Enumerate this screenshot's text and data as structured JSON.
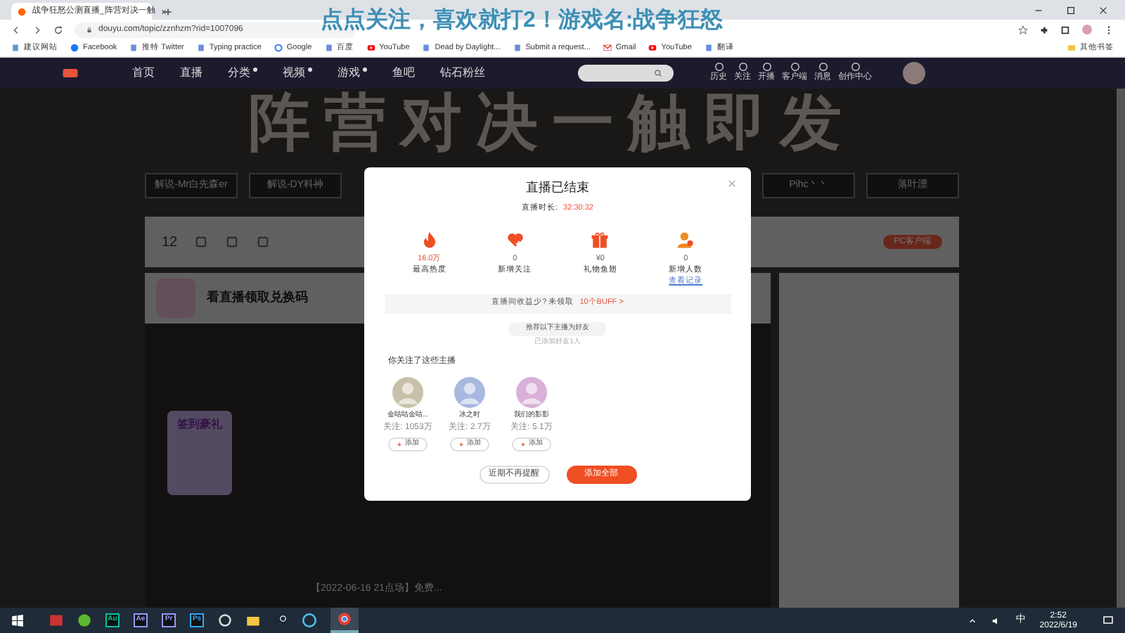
{
  "caption_overlay": "点点关注，喜欢就打2！游戏名:战争狂怒",
  "browser": {
    "tab_title": "战争狂怒公测直播_阵营对决一触",
    "url": "douyu.com/topic/zznhzm?rid=1007096",
    "bookmarks": [
      {
        "label": "建议网站",
        "kind": "page"
      },
      {
        "label": "Facebook",
        "kind": "facebook"
      },
      {
        "label": "推特 Twitter",
        "kind": "page"
      },
      {
        "label": "Typing practice",
        "kind": "page"
      },
      {
        "label": "Google",
        "kind": "google"
      },
      {
        "label": "百度",
        "kind": "page"
      },
      {
        "label": "YouTube",
        "kind": "youtube"
      },
      {
        "label": "Dead by Daylight...",
        "kind": "page"
      },
      {
        "label": "Submit a request...",
        "kind": "page"
      },
      {
        "label": "Gmail",
        "kind": "gmail"
      },
      {
        "label": "YouTube",
        "kind": "youtube"
      },
      {
        "label": "翻译",
        "kind": "page"
      }
    ],
    "other_bookmarks": "其他书签"
  },
  "site_nav": {
    "items": [
      {
        "label": "首页",
        "dropdown": false
      },
      {
        "label": "直播",
        "dropdown": false
      },
      {
        "label": "分类",
        "dropdown": true
      },
      {
        "label": "视频",
        "dropdown": true
      },
      {
        "label": "游戏",
        "dropdown": true
      },
      {
        "label": "鱼吧",
        "dropdown": false
      },
      {
        "label": "钻石粉丝",
        "dropdown": false
      }
    ],
    "actions": [
      {
        "label": "历史"
      },
      {
        "label": "关注"
      },
      {
        "label": "开播"
      },
      {
        "label": "客户端"
      },
      {
        "label": "消息"
      },
      {
        "label": "创作中心"
      }
    ]
  },
  "page": {
    "hero_title": "阵营对决一触即发",
    "commentators": [
      "解说-Mr白先森er",
      "解说-DY科神",
      "Pihc丶丶",
      "落叶漂"
    ],
    "toolbar_count": "12",
    "client_button": "PC客户端",
    "room_title": "看直播领取兑换码",
    "video_caption": "【2022-06-16 21点场】免费...",
    "signin_title": "签到豪礼"
  },
  "modal": {
    "title": "直播已结束",
    "duration_label": "直播时长:",
    "duration": "32:30:32",
    "stats": [
      {
        "kind": "fire",
        "value": "16.0万",
        "label": "最高热度",
        "emphasis": true
      },
      {
        "kind": "heart",
        "value": "0",
        "label": "新增关注",
        "emphasis": false
      },
      {
        "kind": "gift",
        "value": "¥0",
        "label": "礼物鱼翅",
        "emphasis": false
      },
      {
        "kind": "person",
        "value": "0",
        "label": "新增人数",
        "emphasis": false,
        "link": "查看记录"
      }
    ],
    "promo_text": "直播间收益少? 来领取",
    "promo_link": "10个BUFF >",
    "recommend_title": "推荐以下主播为好友",
    "recommend_sub": "已添加好友1人",
    "followed_title": "你关注了这些主播",
    "streamers": [
      {
        "name": "金咕咕金咕...",
        "followers": "关注: 1053万",
        "add": "添加"
      },
      {
        "name": "冰之时",
        "followers": "关注: 2.7万",
        "add": "添加"
      },
      {
        "name": "我们的影影",
        "followers": "关注: 5.1万",
        "add": "添加"
      }
    ],
    "buttons": [
      {
        "label": "近期不再提醒",
        "kind": "secondary"
      },
      {
        "label": "添加全部",
        "kind": "primary"
      }
    ]
  },
  "taskbar": {
    "apps": [
      {
        "label": "Au",
        "color": "#00c8a0"
      },
      {
        "label": "Ae",
        "color": "#9999ff"
      },
      {
        "label": "Pr",
        "color": "#9999ff"
      },
      {
        "label": "Ps",
        "color": "#31a8ff"
      }
    ],
    "ime": "中",
    "time": "2:52",
    "date": "2022/6/19"
  }
}
